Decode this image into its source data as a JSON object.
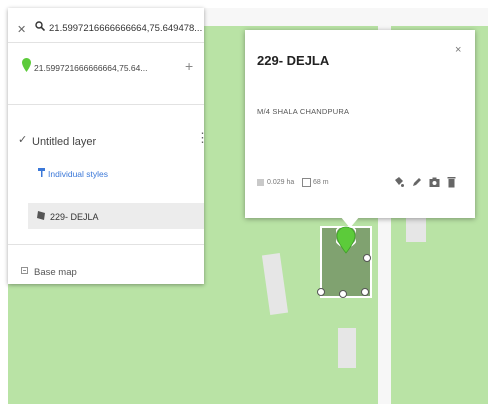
{
  "search": {
    "query": "21.5997216666666664,75.649478..."
  },
  "result": {
    "coordinates": "21.599721666666664,75.64..."
  },
  "layer": {
    "title": "Untitled layer",
    "styles_link": "Individual styles",
    "feature_label": "229- DEJLA"
  },
  "basemap": {
    "label": "Base map"
  },
  "popup": {
    "title": "229- DEJLA",
    "description": "M/4 SHALA CHANDPURA",
    "area": "0.029 ha",
    "perimeter": "68 m"
  },
  "icons": {
    "close": "close-icon",
    "search": "search-icon",
    "pin": "map-pin-icon",
    "add": "plus-icon",
    "check": "check-icon",
    "more": "more-vert-icon",
    "styles": "paint-roller-icon",
    "feature": "polygon-icon",
    "basemap": "expand-icon",
    "style_edit": "paint-bucket-icon",
    "edit": "pencil-icon",
    "photo": "camera-icon",
    "delete": "trash-icon"
  },
  "colors": {
    "map_green": "#b9e3a5",
    "road": "#f7f7f7",
    "polygon_fill": "#6e8c5f",
    "marker": "#5ccb3a",
    "link_blue": "#3b78d8"
  }
}
